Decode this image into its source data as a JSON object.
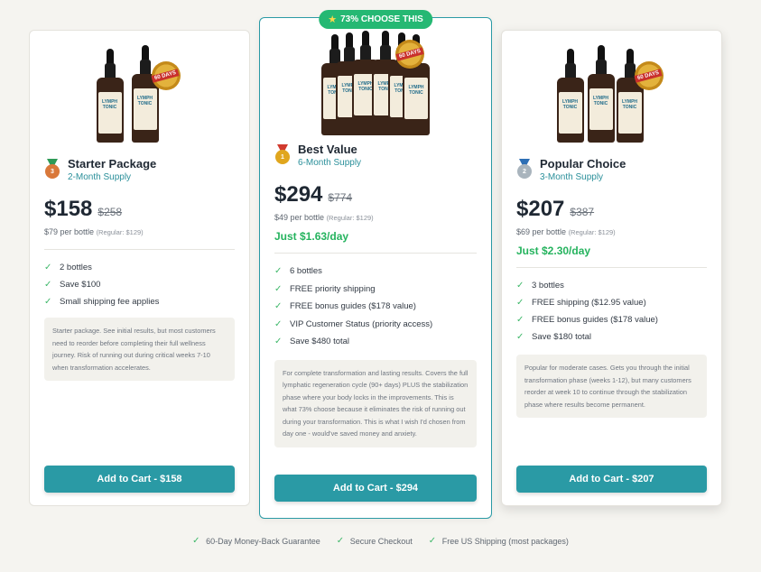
{
  "plans": [
    {
      "name": "Starter Package",
      "subtitle": "2-Month Supply",
      "price": "$158",
      "old_price": "$258",
      "per_bottle": "$79 per bottle",
      "regular": "(Regular: $129)",
      "daily": "",
      "features": [
        "2 bottles",
        "Save $100",
        "Small shipping fee applies"
      ],
      "note": "Starter package. See initial results, but most customers need to reorder before completing their full wellness journey. Risk of running out during critical weeks 7-10 when transformation accelerates.",
      "button": "Add to Cart - $158",
      "medal_icon": "bronze-medal-icon",
      "product_label": "LYMPH TONIC",
      "seal_text": "60 DAYS"
    },
    {
      "badge": "73% CHOOSE THIS",
      "name": "Best Value",
      "subtitle": "6-Month Supply",
      "price": "$294",
      "old_price": "$774",
      "per_bottle": "$49 per bottle",
      "regular": "(Regular: $129)",
      "daily": "Just $1.63/day",
      "features": [
        "6 bottles",
        "FREE priority shipping",
        "FREE bonus guides ($178 value)",
        "VIP Customer Status (priority access)",
        "Save $480 total"
      ],
      "note": "For complete transformation and lasting results. Covers the full lymphatic regeneration cycle (90+ days) PLUS the stabilization phase where your body locks in the improvements. This is what 73% choose because it eliminates the risk of running out during your transformation. This is what I wish I'd chosen from day one - would've saved money and anxiety.",
      "button": "Add to Cart - $294",
      "medal_icon": "gold-medal-icon",
      "product_label": "LYMPH TONIC",
      "seal_text": "60 DAYS"
    },
    {
      "name": "Popular Choice",
      "subtitle": "3-Month Supply",
      "price": "$207",
      "old_price": "$387",
      "per_bottle": "$69 per bottle",
      "regular": "(Regular: $129)",
      "daily": "Just $2.30/day",
      "features": [
        "3 bottles",
        "FREE shipping ($12.95 value)",
        "FREE bonus guides ($178 value)",
        "Save $180 total"
      ],
      "note": "Popular for moderate cases. Gets you through the initial transformation phase (weeks 1-12), but many customers reorder at week 10 to continue through the stabilization phase where results become permanent.",
      "button": "Add to Cart - $207",
      "medal_icon": "silver-medal-icon",
      "product_label": "LYMPH TONIC",
      "seal_text": "60 DAYS"
    }
  ],
  "footer": [
    "60-Day Money-Back Guarantee",
    "Secure Checkout",
    "Free US Shipping (most packages)"
  ],
  "colors": {
    "accent": "#2a9aa5",
    "green": "#25b35e",
    "badge": "#25b873"
  }
}
